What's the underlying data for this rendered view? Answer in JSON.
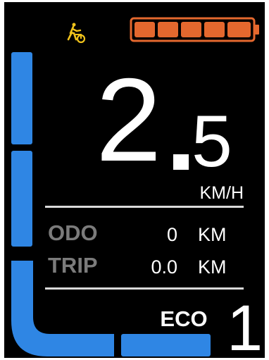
{
  "display": {
    "walk_icon": "walk-assist-icon",
    "battery": {
      "bars": 5,
      "filled": 5,
      "color": "#e4682e"
    },
    "speed": {
      "integer": "2",
      "decimal": "5",
      "unit": "KM/H"
    },
    "stats": {
      "odo": {
        "label": "ODO",
        "value": "0",
        "unit": "KM"
      },
      "trip": {
        "label": "TRIP",
        "value": "0.0",
        "unit": "KM"
      }
    },
    "mode": "ECO",
    "assist_level": "1",
    "gauge": {
      "color": "#2f86e4",
      "segments": 4,
      "active_segments": 4
    }
  }
}
